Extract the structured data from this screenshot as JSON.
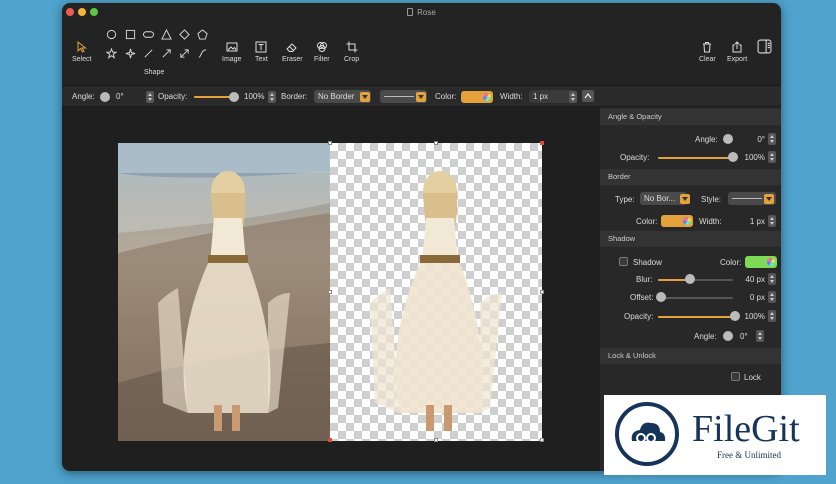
{
  "window": {
    "title": "Rose"
  },
  "colors": {
    "accent": "#e3a33a",
    "shadow_color": "#7ed957",
    "close": "#ee5b52",
    "minimize": "#f1b53a",
    "zoom": "#5fc54a"
  },
  "toolbar": {
    "select": "Select",
    "shape": "Shape",
    "image": "Image",
    "text": "Text",
    "eraser": "Eraser",
    "filter": "Filter",
    "crop": "Crop",
    "clear": "Clear",
    "export": "Export"
  },
  "propbar": {
    "angle_label": "Angle:",
    "angle_value": "0°",
    "opacity_label": "Opacity:",
    "opacity_value": "100%",
    "opacity_fraction": 1.0,
    "border_label": "Border:",
    "border_value": "No Border",
    "color_label": "Color:",
    "width_label": "Width:",
    "width_value": "1 px"
  },
  "panel": {
    "angle_opacity": {
      "title": "Angle & Opacity",
      "angle_label": "Angle:",
      "angle_value": "0°",
      "opacity_label": "Opacity:",
      "opacity_value": "100%",
      "opacity_fraction": 1.0
    },
    "border": {
      "title": "Border",
      "type_label": "Type:",
      "type_value": "No Bor...",
      "style_label": "Style:",
      "color_label": "Color:",
      "width_label": "Width:",
      "width_value": "1 px"
    },
    "shadow": {
      "title": "Shadow",
      "shadow_label": "Shadow",
      "color_label": "Color:",
      "blur_label": "Blur:",
      "blur_value": "40 px",
      "offset_label": "Offset:",
      "offset_value": "0 px",
      "opacity_label": "Opacity:",
      "opacity_value": "100%",
      "angle_label": "Angle:",
      "angle_value": "0°"
    },
    "lock": {
      "title": "Lock & Unlock",
      "lock_label": "Lock"
    }
  },
  "watermark": {
    "brand": "FileGit",
    "tagline": "Free & Unlimited"
  }
}
